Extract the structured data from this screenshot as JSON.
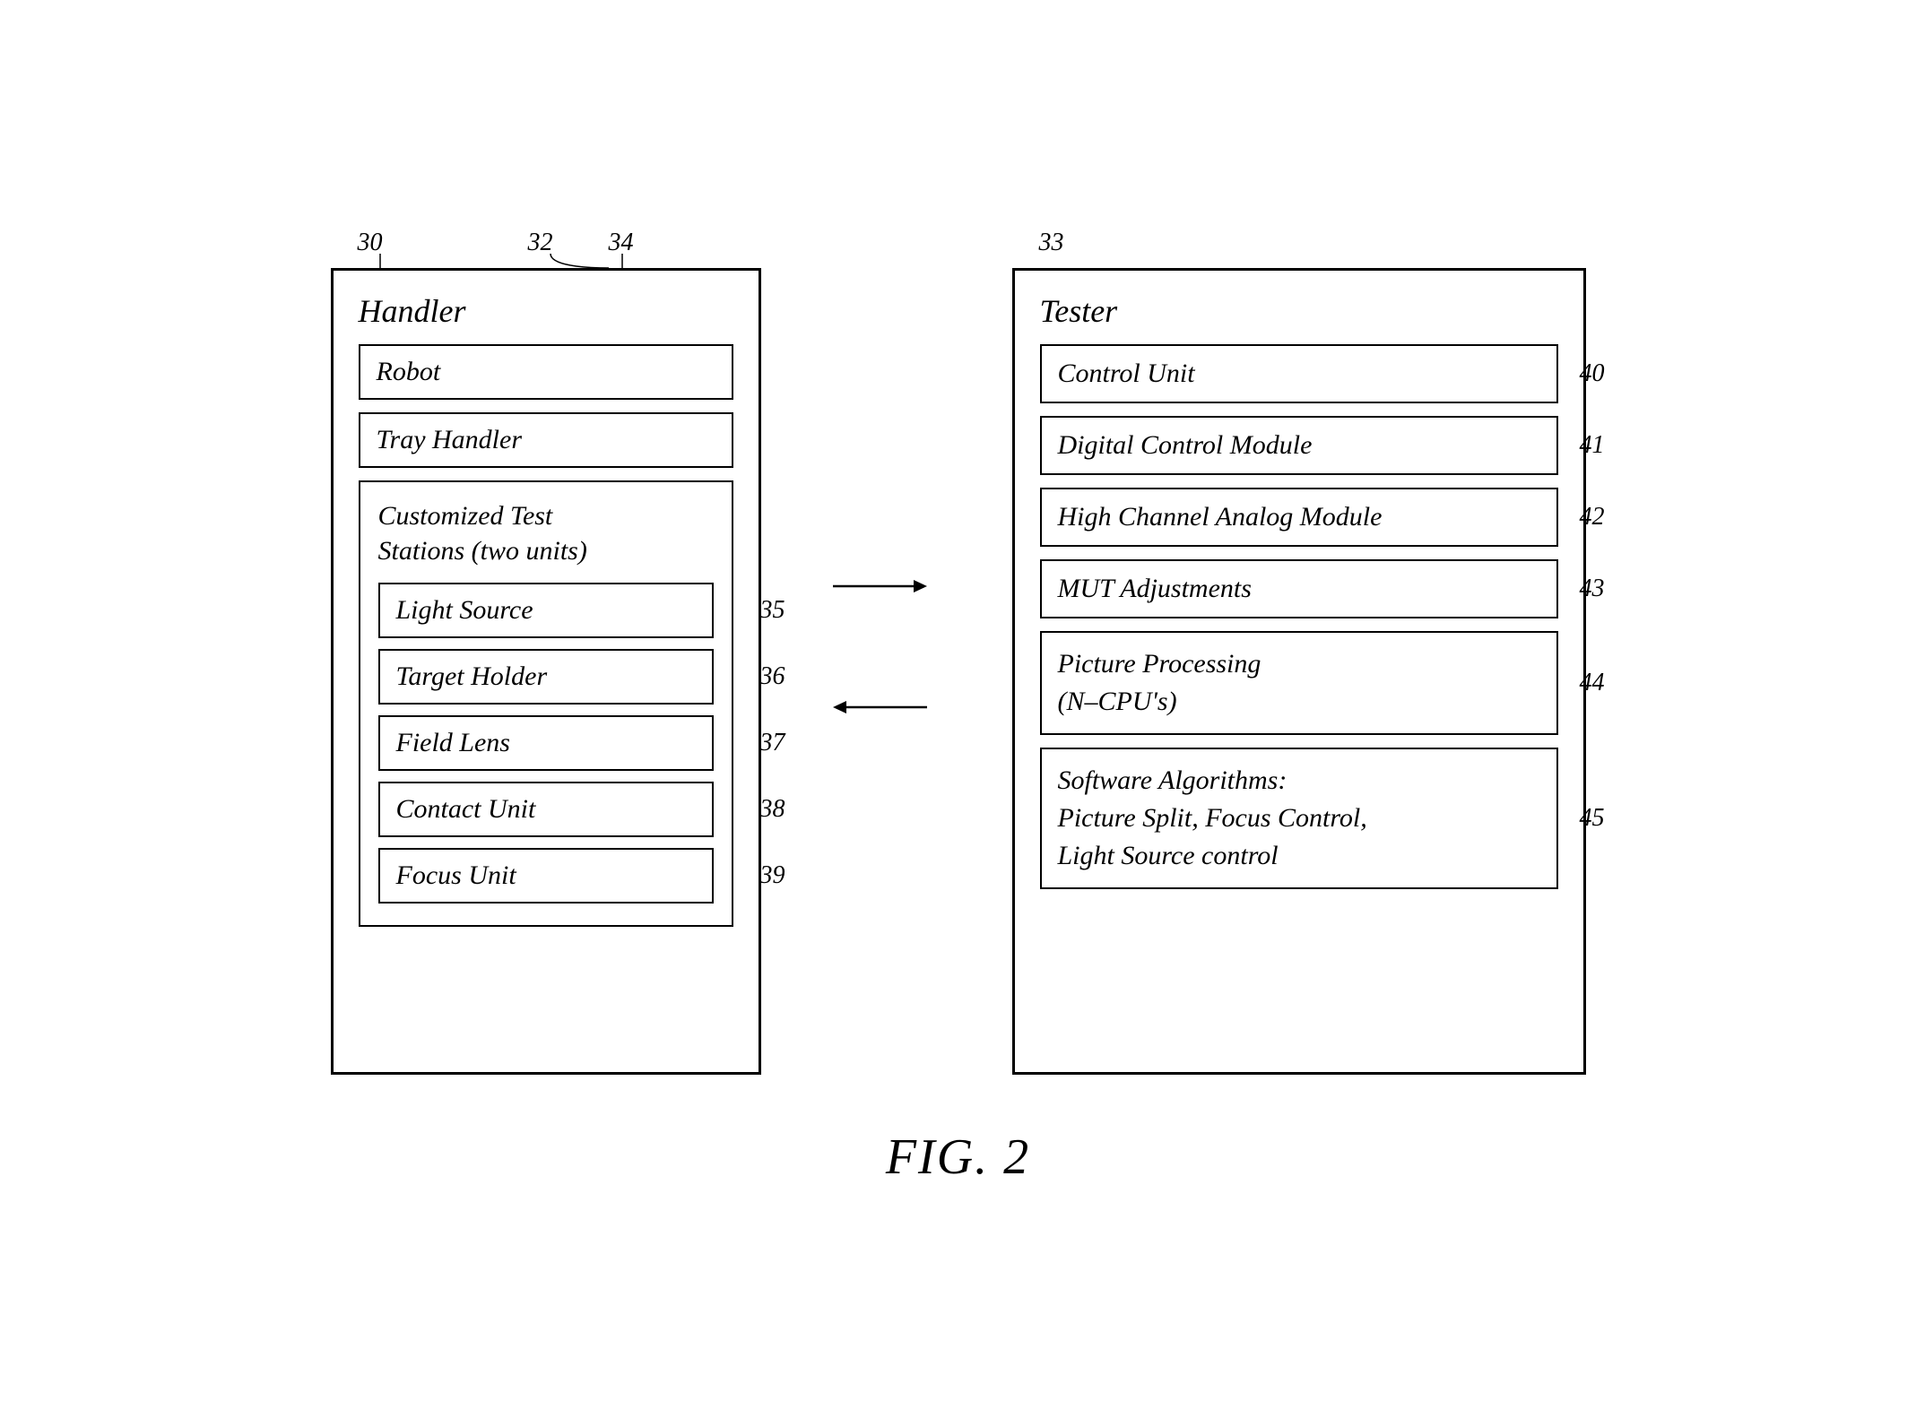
{
  "left_panel": {
    "tag_30": "30",
    "tag_32": "32",
    "tag_34": "34",
    "label": "Handler",
    "robot_label": "Robot",
    "tray_label": "Tray Handler",
    "inner_panel": {
      "label_line1": "Customized Test",
      "label_line2": "Stations (two units)",
      "light_source": "Light Source",
      "target_holder": "Target Holder",
      "field_lens": "Field Lens",
      "contact_unit": "Contact Unit",
      "focus_unit": "Focus Unit",
      "ref_35": "35",
      "ref_36": "36",
      "ref_37": "37",
      "ref_38": "38",
      "ref_39": "39"
    }
  },
  "right_panel": {
    "tag_33": "33",
    "label": "Tester",
    "items": [
      {
        "text": "Control Unit",
        "ref": "40"
      },
      {
        "text": "Digital Control Module",
        "ref": "41"
      },
      {
        "text": "High Channel Analog Module",
        "ref": "42"
      },
      {
        "text": "MUT Adjustments",
        "ref": "43"
      },
      {
        "text": "Picture Processing\n(N–CPU's)",
        "ref": "44"
      },
      {
        "text": "Software Algorithms:\nPicture Split, Focus Control,\nLight Source control",
        "ref": "45"
      }
    ]
  },
  "figure_caption": "FIG. 2"
}
